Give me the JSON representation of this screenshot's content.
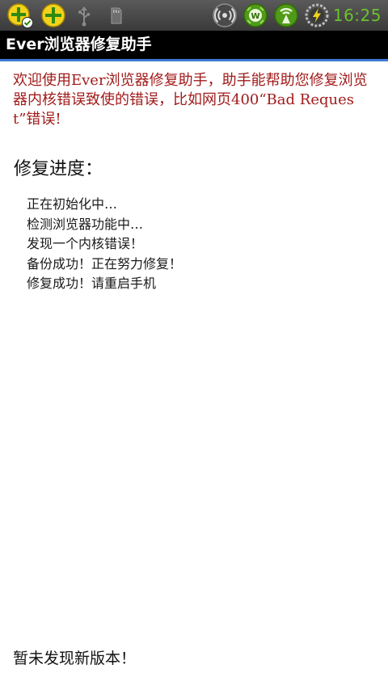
{
  "status_bar": {
    "icons": [
      "add-with-check-icon",
      "add-icon",
      "usb-icon",
      "sd-card-icon",
      "signal-broadcast-icon",
      "widget-w-icon",
      "wifi-antenna-icon",
      "battery-charging-icon"
    ],
    "time": "16:25",
    "time_color": "#6cc22a"
  },
  "title_bar": {
    "title": "Ever浏览器修复助手",
    "accent_color": "#3b7bd6"
  },
  "content": {
    "intro": "欢迎使用Ever浏览器修复助手，助手能帮助您修复浏览器内核错误致使的错误，比如网页400“Bad Request”错误!",
    "intro_color": "#a11b1b",
    "progress_heading": "修复进度：",
    "log_lines": [
      "正在初始化中…",
      "检测浏览器功能中…",
      "发现一个内核错误！",
      "备份成功！正在努力修复！",
      "修复成功！请重启手机"
    ],
    "footer": "暂未发现新版本！"
  }
}
